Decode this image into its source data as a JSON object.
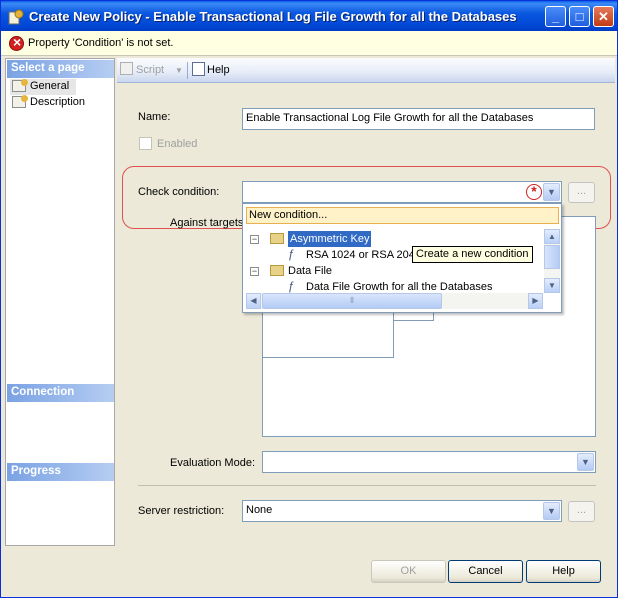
{
  "window": {
    "title": "Create New Policy - Enable Transactional Log File Growth for all the Databases",
    "minimize_glyph": "_",
    "maximize_glyph": "□",
    "close_glyph": "✕"
  },
  "error": {
    "message": "Property 'Condition' is not set."
  },
  "sidebar": {
    "select_page_header": "Select a page",
    "pages": [
      {
        "label": "General"
      },
      {
        "label": "Description"
      }
    ],
    "connection_header": "Connection",
    "progress_header": "Progress"
  },
  "toolbar": {
    "script_label": "Script",
    "help_label": "Help"
  },
  "form": {
    "name_label": "Name:",
    "name_value": "Enable Transactional Log File Growth for all the Databases",
    "enabled_label": "Enabled",
    "check_condition_label": "Check condition:",
    "check_condition_value": "",
    "required_glyph": "*",
    "ellipsis": "...",
    "against_targets_label": "Against targets:",
    "evaluation_mode_label": "Evaluation Mode:",
    "evaluation_mode_value": "",
    "server_restriction_label": "Server restriction:",
    "server_restriction_value": "None"
  },
  "dropdown": {
    "new_condition": "New condition...",
    "tree": [
      {
        "label": "Asymmetric Key",
        "kind": "facet",
        "selected": true
      },
      {
        "label": "RSA 1024 or RSA 2048",
        "kind": "condition"
      },
      {
        "label": "Data File",
        "kind": "facet"
      },
      {
        "label": "Data File Growth for all the Databases",
        "kind": "condition"
      }
    ],
    "tooltip": "Create a new condition"
  },
  "buttons": {
    "ok": "OK",
    "cancel": "Cancel",
    "help": "Help"
  },
  "colors": {
    "title_bar": "#0054e3",
    "section_header": "#7aa2e3",
    "selection": "#316ac5",
    "error_ring": "#e05050"
  }
}
